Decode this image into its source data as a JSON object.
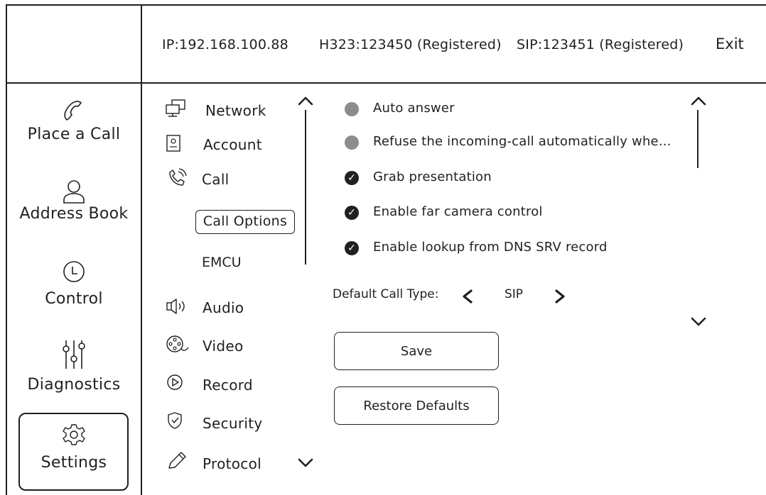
{
  "header": {
    "ip": "IP:192.168.100.88",
    "h323": "H323:123450 (Registered)",
    "sip": "SIP:123451 (Registered)",
    "exit_label": "Exit"
  },
  "nav": {
    "place_call": "Place a Call",
    "address_book": "Address Book",
    "control": "Control",
    "diagnostics": "Diagnostics",
    "settings": "Settings"
  },
  "categories": {
    "network": "Network",
    "account": "Account",
    "call": "Call",
    "call_options": "Call Options",
    "emcu": "EMCU",
    "audio": "Audio",
    "video": "Video",
    "record": "Record",
    "security": "Security",
    "protocol": "Protocol"
  },
  "options": [
    {
      "label": "Auto answer",
      "checked": false
    },
    {
      "label": "Refuse the incoming-call automatically whe...",
      "checked": false
    },
    {
      "label": "Grab presentation",
      "checked": true
    },
    {
      "label": "Enable far camera control",
      "checked": true
    },
    {
      "label": "Enable lookup from DNS SRV record",
      "checked": true
    }
  ],
  "call_type": {
    "label": "Default Call Type:",
    "value": "SIP"
  },
  "buttons": {
    "save": "Save",
    "restore": "Restore Defaults"
  },
  "colors": {
    "line": "#231f20",
    "unchecked": "#8c8c8c"
  }
}
